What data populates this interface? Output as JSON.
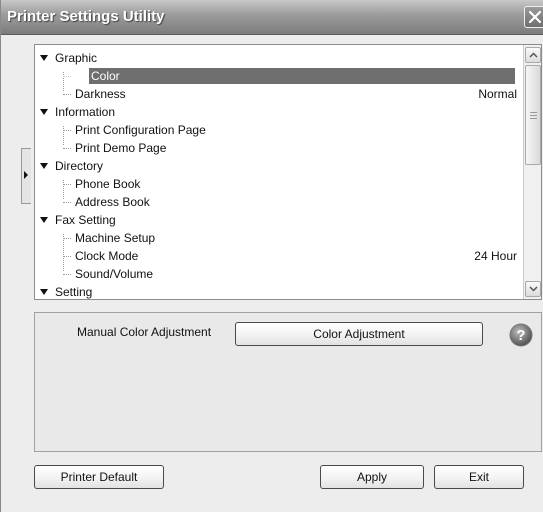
{
  "window": {
    "title": "Printer Settings Utility",
    "close_symbol": "✕"
  },
  "tree": {
    "rows": [
      {
        "label": "Graphic",
        "value": ""
      },
      {
        "label": "Color",
        "value": ""
      },
      {
        "label": "Darkness",
        "value": "Normal"
      },
      {
        "label": "Information",
        "value": ""
      },
      {
        "label": "Print Configuration Page",
        "value": ""
      },
      {
        "label": "Print Demo Page",
        "value": ""
      },
      {
        "label": "Directory",
        "value": ""
      },
      {
        "label": "Phone Book",
        "value": ""
      },
      {
        "label": "Address Book",
        "value": ""
      },
      {
        "label": "Fax Setting",
        "value": ""
      },
      {
        "label": "Machine Setup",
        "value": ""
      },
      {
        "label": "Clock Mode",
        "value": "24 Hour"
      },
      {
        "label": "Sound/Volume",
        "value": ""
      },
      {
        "label": "Setting",
        "value": ""
      }
    ],
    "selected_label": "Color"
  },
  "settings": {
    "label": "Manual Color Adjustment",
    "button": "Color Adjustment",
    "help_icon": "help-question-icon"
  },
  "buttons": {
    "printer_default": "Printer Default",
    "apply": "Apply",
    "exit": "Exit"
  },
  "colors": {
    "selection": "#6e6e6e",
    "titlebar": "#8a8a8a"
  }
}
